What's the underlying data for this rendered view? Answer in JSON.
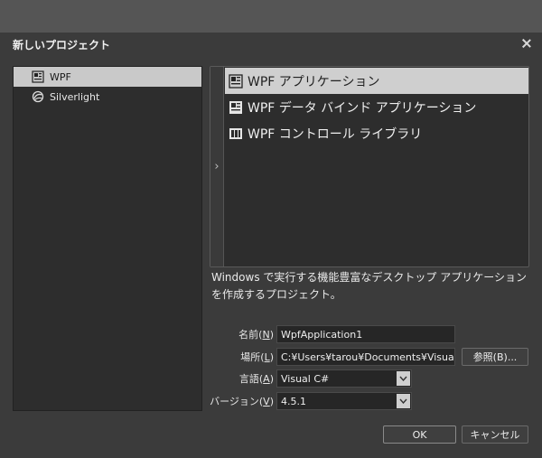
{
  "dialog": {
    "title": "新しいプロジェクト"
  },
  "tree": [
    {
      "label": "WPF",
      "selected": true,
      "icon": "wpf-icon"
    },
    {
      "label": "Silverlight",
      "selected": false,
      "icon": "silverlight-icon"
    }
  ],
  "templates": [
    {
      "label": "WPF アプリケーション",
      "selected": true,
      "icon": "wpf-app-icon"
    },
    {
      "label": "WPF データ バインド アプリケーション",
      "selected": false,
      "icon": "wpf-databind-icon"
    },
    {
      "label": "WPF コントロール ライブラリ",
      "selected": false,
      "icon": "wpf-control-library-icon"
    }
  ],
  "description": {
    "line1": "Windows で実行する機能豊富なデスクトップ アプリケーション",
    "line2": "を作成するプロジェクト。"
  },
  "form": {
    "name_label_prefix": "名前(",
    "name_label_key": "N",
    "name_label_suffix": ")",
    "name_value": "WpfApplication1",
    "location_label_prefix": "場所(",
    "location_label_key": "L",
    "location_label_suffix": ")",
    "location_value": "C:¥Users¥tarou¥Documents¥Visual",
    "browse_label": "参照(B)...",
    "language_label_prefix": "言語(",
    "language_label_key": "A",
    "language_label_suffix": ")",
    "language_value": "Visual C#",
    "version_label_prefix": "バージョン(",
    "version_label_key": "V",
    "version_label_suffix": ")",
    "version_value": "4.5.1"
  },
  "buttons": {
    "ok": "OK",
    "cancel": "キャンセル"
  },
  "colors": {
    "selection": "#c9c9c9",
    "panel": "#2d2d2d",
    "dialog": "#3b3b3b"
  }
}
